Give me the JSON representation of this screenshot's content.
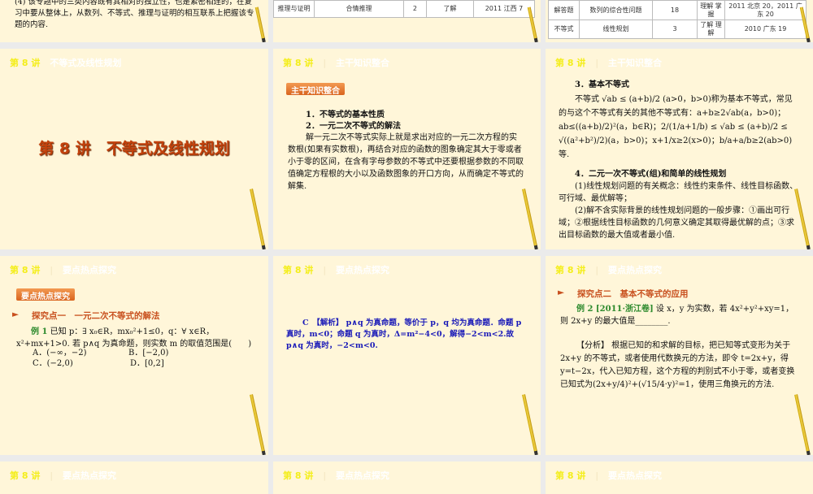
{
  "header": {
    "lecture": "第 8 讲",
    "topic_title": "不等式及线性规划",
    "topic_main": "主干知识整合",
    "topic_hot": "要点热点探究"
  },
  "slide_a": {
    "text": "(4) 该专题中的三类内容既有其相对的独立性，也是紧密相连的，在复习中要从整体上，从数列、不等式、推理与证明的相互联系上把握该专题的内容."
  },
  "slide_b": {
    "row": [
      "推理与证明",
      "合情推理",
      "2",
      "了解",
      "2011 江西 7"
    ]
  },
  "slide_c": {
    "rows": [
      [
        "解答题",
        "数列的综合性问题",
        "18",
        "理解 掌握",
        "2011 北京 20，2011 广东 20"
      ],
      [
        "不等式",
        "线性规划",
        "3",
        "了解 理解",
        "2010 广东 19"
      ]
    ]
  },
  "title_slide": {
    "title": "第 8 讲　不等式及线性规划"
  },
  "main_slide1": {
    "tag": "主干知识整合",
    "h1": "1．不等式的基本性质",
    "h2": "2．一元二次不等式的解法",
    "p": "解一元二次不等式实际上就是求出对应的一元二次方程的实数根(如果有实数根)，再结合对应的函数的图象确定其大于零或者小于零的区间，在含有字母参数的不等式中还要根据参数的不同取值确定方程根的大小以及函数图象的开口方向，从而确定不等式的解集."
  },
  "main_slide2": {
    "h3": "3．基本不等式",
    "p1": "不等式 √ab ≤ (a+b)/2 (a>0，b>0)称为基本不等式，常见的与这个不等式有关的其他不等式有：a+b≥2√ab(a，b>0)；ab≤((a+b)/2)²(a，b∈R)；2/(1/a+1/b) ≤ √ab ≤ (a+b)/2 ≤ √((a²+b²)/2)(a，b>0)；x+1/x≥2(x>0)；b/a+a/b≥2(ab>0)等.",
    "h4": "4．二元一次不等式(组)和简单的线性规划",
    "p2": "(1)线性规划问题的有关概念：线性约束条件、线性目标函数、可行域、最优解等；",
    "p3": "(2)解不含实际背景的线性规划问题的一般步骤：①画出可行域；②根据线性目标函数的几何意义确定其取得最优解的点；③求出目标函数的最大值或者最小值."
  },
  "hot_slide1": {
    "tag": "要点热点探究",
    "sec": "探究点一　一元二次不等式的解法",
    "ex": "例 1",
    "q": "已知 p：∃ x₀∈R，mx₀²+1≤0，q：∀ x∈R，x²+mx+1>0. 若 p∧q 为真命题，则实数 m 的取值范围是(　　)",
    "A": "A．(−∞，−2)",
    "B": "B．[−2,0)",
    "C": "C．(−2,0)",
    "D": "D．[0,2]"
  },
  "hot_slide2": {
    "ans": "C　【解析】 p∧q 为真命题，等价于 p，q 均为真命题．命题 p 真时，m<0；命题 q 为真时，Δ=m²−4<0，解得−2<m<2.故 p∧q 为真时，−2<m<0."
  },
  "hot_slide3": {
    "sec": "探究点二　基本不等式的应用",
    "ex": "例 2 [2011·浙江卷]",
    "q": "设 x，y 为实数，若 4x²+y²+xy=1，则 2x+y 的最大值是________.",
    "analysis": "【分析】 根据已知的和求解的目标，把已知等式变形为关于 2x+y 的不等式，或者使用代数换元的方法，即令 t=2x+y，得 y=t−2x，代入已知方程，这个方程的判别式不小于零，或者变换已知式为(2x+y/4)²+(√15/4·y)²=1，使用三角换元的方法."
  }
}
